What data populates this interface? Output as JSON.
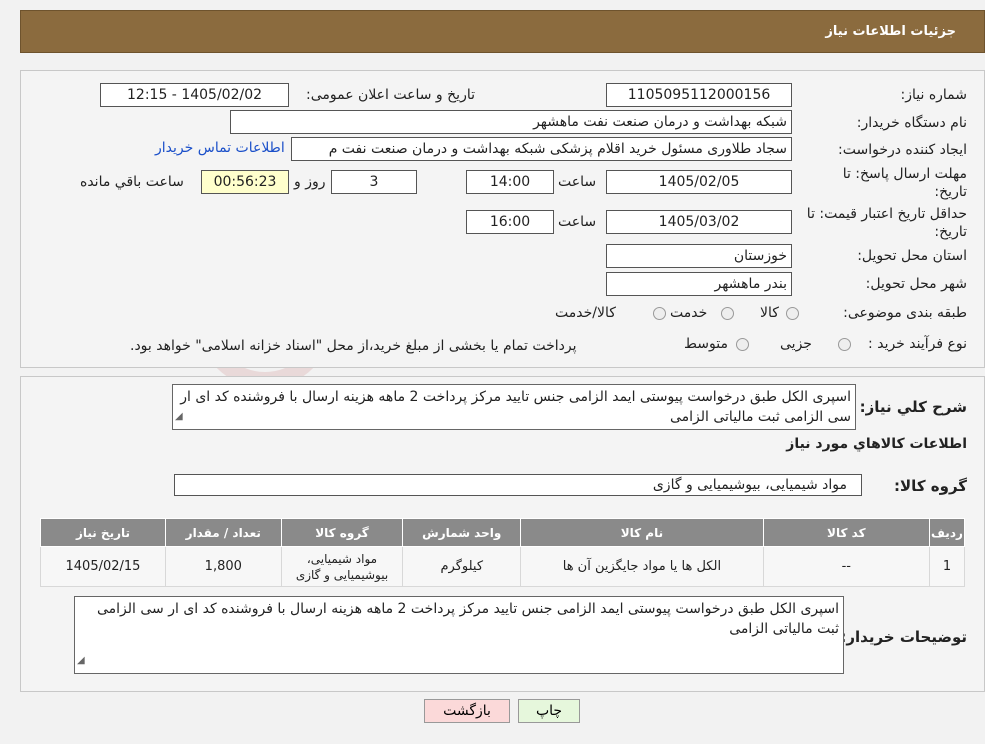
{
  "header": {
    "title": "جزئیات اطلاعات نیاز"
  },
  "form": {
    "need_number_label": "شماره نیاز:",
    "need_number": "1105095112000156",
    "announce_label": "تاریخ و ساعت اعلان عمومی:",
    "announce_value": "1405/02/02 - 12:15",
    "buyer_org_label": "نام دستگاه خریدار:",
    "buyer_org": "شبکه بهداشت و درمان صنعت نفت ماهشهر",
    "creator_label": "ایجاد کننده درخواست:",
    "creator": "سجاد طلاوری مسئول خرید اقلام پزشکی شبکه بهداشت و درمان صنعت نفت م",
    "contact_link": "اطلاعات تماس خریدار",
    "deadline_label_1": "مهلت ارسال پاسخ: تا",
    "deadline_label_2": "تاریخ:",
    "deadline_date": "1405/02/05",
    "time_label": "ساعت",
    "deadline_time": "14:00",
    "days_value": "3",
    "days_label": "روز و",
    "remaining_time": "00:56:23",
    "remaining_label": "ساعت باقي مانده",
    "validity_label_1": "حداقل تاریخ اعتبار قیمت: تا",
    "validity_label_2": "تاریخ:",
    "validity_date": "1405/03/02",
    "validity_time": "16:00",
    "province_label": "استان محل تحویل:",
    "province": "خوزستان",
    "city_label": "شهر محل تحویل:",
    "city": "بندر ماهشهر",
    "category_label": "طبقه بندی موضوعی:",
    "category_options": [
      "کالا",
      "خدمت",
      "کالا/خدمت"
    ],
    "process_label": "نوع فرآیند خرید :",
    "process_options": [
      "جزیی",
      "متوسط"
    ],
    "process_note": "پرداخت تمام یا بخشی از مبلغ خرید،از محل \"اسناد خزانه اسلامی\" خواهد بود."
  },
  "details": {
    "summary_label": "شرح کلي نياز:",
    "summary": "اسپری الکل طبق درخواست پیوستی ایمد الزامی جنس تایید مرکز پرداخت 2 ماهه هزینه ارسال با فروشنده کد ای ار سی الزامی ثبت مالیاتی الزامی",
    "goods_info_title": "اطلاعات کالاهاي مورد نياز",
    "goods_group_label": "گروه کالا:",
    "goods_group": "مواد شیمیایی، بیوشیمیایی و  گازی",
    "table": {
      "headers": [
        "ردیف",
        "کد کالا",
        "نام کالا",
        "واحد شمارش",
        "گروه کالا",
        "تعداد / مقدار",
        "تاریخ نیاز"
      ],
      "rows": [
        [
          "1",
          "--",
          "الکل ها یا مواد جایگزین آن ها",
          "کیلوگرم",
          "مواد شیمیایی، بیوشیمیایی و گازی",
          "1,800",
          "1405/02/15"
        ]
      ]
    },
    "buyer_notes_label": "توضیحات خریدار:",
    "buyer_notes": "اسپری الکل طبق درخواست پیوستی ایمد الزامی جنس تایید مرکز پرداخت 2 ماهه هزینه ارسال با فروشنده کد ای ار سی الزامی ثبت مالیاتی الزامی"
  },
  "buttons": {
    "print": "چاپ",
    "back": "بازگشت"
  },
  "watermark": {
    "text": "AriaTender.neT"
  },
  "colors": {
    "header_bg": "#8b6b3e",
    "link": "#1a4fc9",
    "table_header": "#8a8a8a",
    "back_btn": "#fbd9d9",
    "print_btn": "#e6f7dc"
  }
}
